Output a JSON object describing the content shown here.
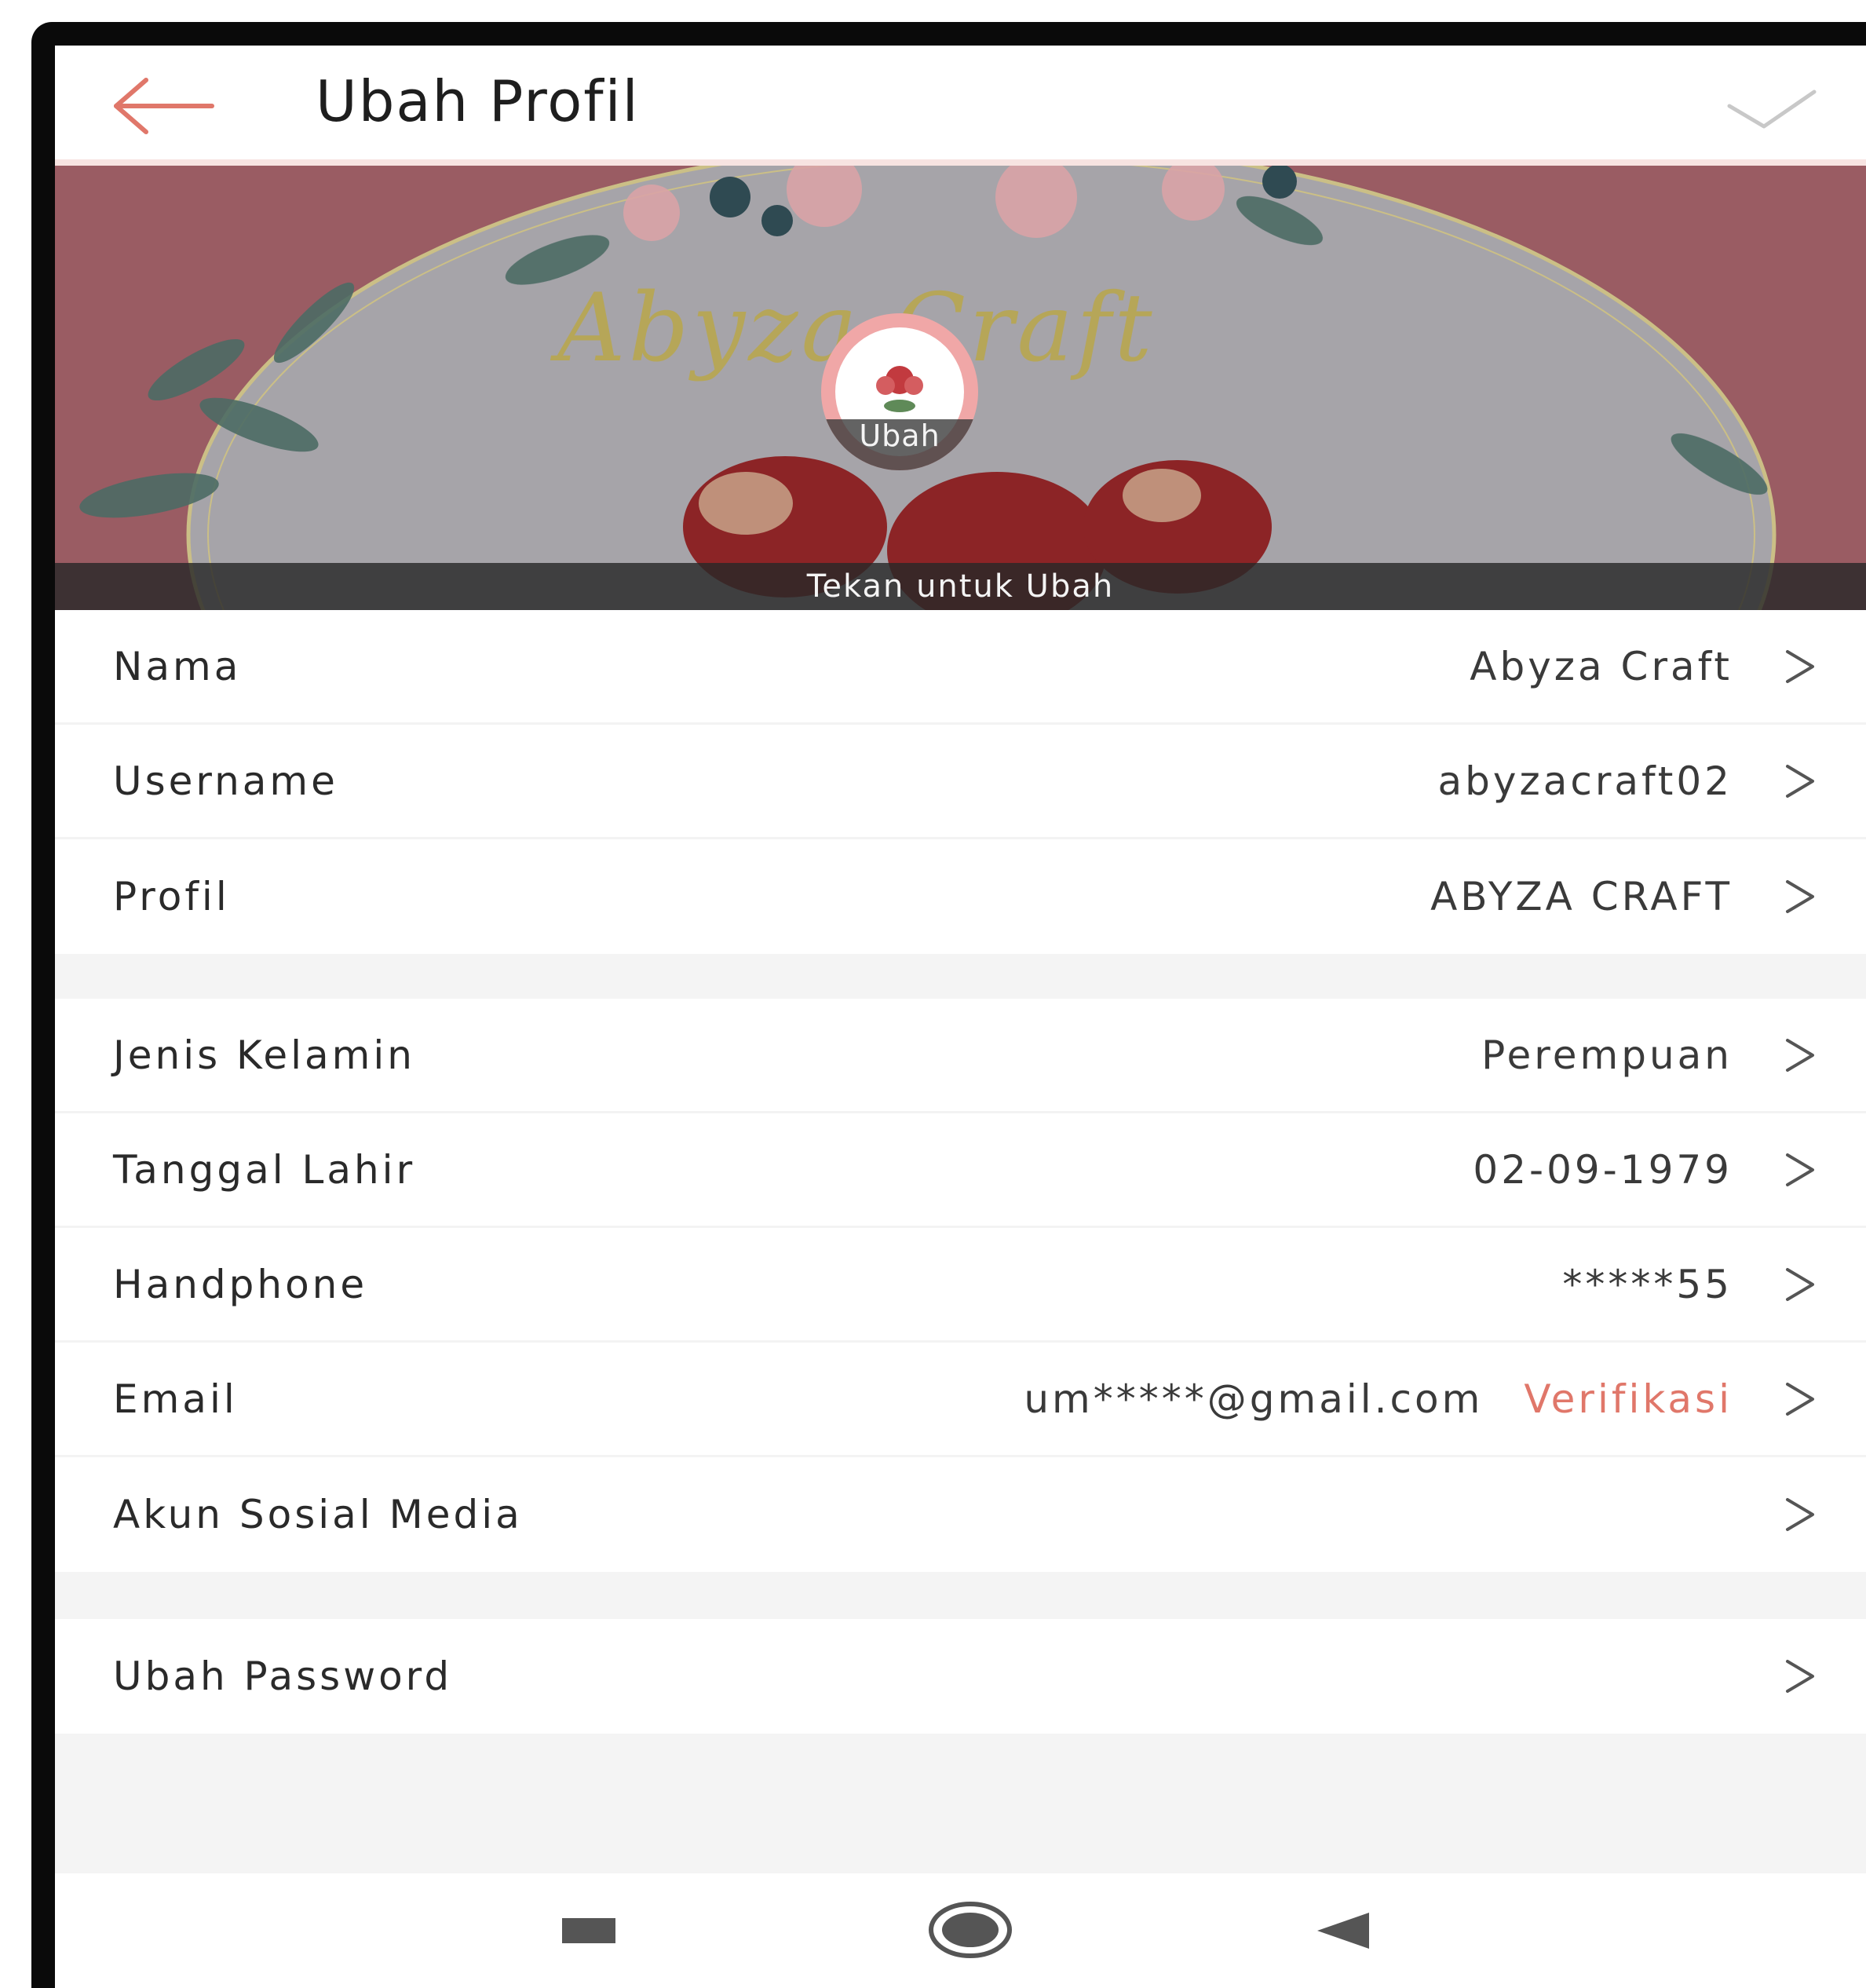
{
  "header": {
    "title": "Ubah Profil"
  },
  "cover": {
    "brand_text": "Abyza Craft",
    "avatar_label": "Ubah",
    "bar_label": "Tekan untuk Ubah"
  },
  "groups": [
    {
      "rows": [
        {
          "label": "Nama",
          "value": "Abyza Craft"
        },
        {
          "label": "Username",
          "value": "abyzacraft02"
        },
        {
          "label": "Profil",
          "value": "ABYZA CRAFT"
        }
      ]
    },
    {
      "rows": [
        {
          "label": "Jenis Kelamin",
          "value": "Perempuan"
        },
        {
          "label": "Tanggal Lahir",
          "value": "02-09-1979"
        },
        {
          "label": "Handphone",
          "value": "*****55"
        },
        {
          "label": "Email",
          "value": "um*****@gmail.com",
          "action": "Verifikasi"
        },
        {
          "label": "Akun Sosial Media",
          "value": ""
        }
      ]
    },
    {
      "rows": [
        {
          "label": "Ubah Password",
          "value": ""
        }
      ]
    }
  ],
  "colors": {
    "accent": "#e0776a",
    "cover": "#9a5c63",
    "verify": "#e0776a"
  },
  "icons": {
    "back": "arrow-left-icon",
    "confirm": "check-icon",
    "row": "chevron-right-icon",
    "nav_recent": "square-icon",
    "nav_home": "circle-icon",
    "nav_back": "triangle-left-icon"
  }
}
